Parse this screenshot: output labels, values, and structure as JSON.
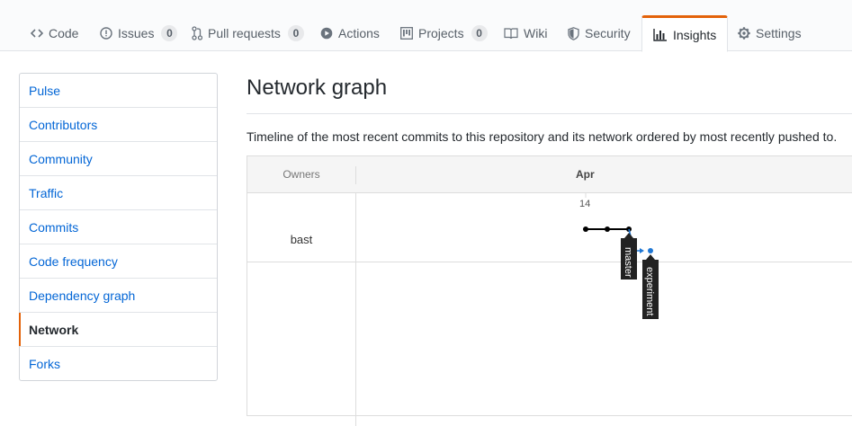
{
  "nav": {
    "tabs": [
      {
        "label": "Code",
        "icon": "code-icon"
      },
      {
        "label": "Issues",
        "icon": "issue-icon",
        "count": "0"
      },
      {
        "label": "Pull requests",
        "icon": "pull-request-icon",
        "count": "0"
      },
      {
        "label": "Actions",
        "icon": "play-icon"
      },
      {
        "label": "Projects",
        "icon": "project-icon",
        "count": "0"
      },
      {
        "label": "Wiki",
        "icon": "book-icon"
      },
      {
        "label": "Security",
        "icon": "shield-icon"
      },
      {
        "label": "Insights",
        "icon": "graph-icon",
        "selected": true
      },
      {
        "label": "Settings",
        "icon": "gear-icon"
      }
    ]
  },
  "sidebar": {
    "items": [
      {
        "label": "Pulse"
      },
      {
        "label": "Contributors"
      },
      {
        "label": "Community"
      },
      {
        "label": "Traffic"
      },
      {
        "label": "Commits"
      },
      {
        "label": "Code frequency"
      },
      {
        "label": "Dependency graph"
      },
      {
        "label": "Network",
        "selected": true
      },
      {
        "label": "Forks"
      }
    ]
  },
  "main": {
    "title": "Network graph",
    "description": "Timeline of the most recent commits to this repository and its network ordered by most recently pushed to."
  },
  "network": {
    "owners_header": "Owners",
    "month": "Apr",
    "day": "14",
    "owner": "bast",
    "branches": [
      {
        "name": "master",
        "color": "#000000"
      },
      {
        "name": "experiment",
        "color": "#1f77d4"
      }
    ]
  }
}
